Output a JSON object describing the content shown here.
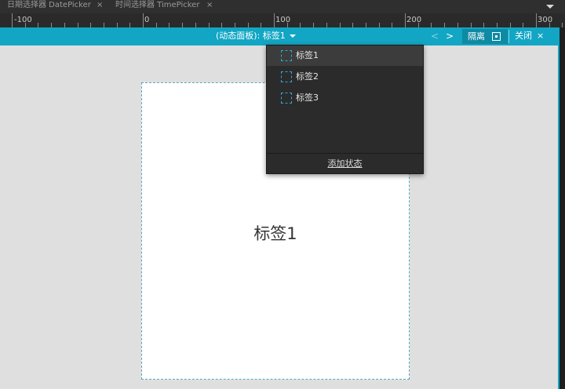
{
  "tabs": [
    {
      "label": "日期选择器 DatePicker",
      "close": "×"
    },
    {
      "label": "时间选择器 TimePicker",
      "close": "×"
    }
  ],
  "ruler": {
    "labels": [
      "-100",
      "0",
      "100",
      "200",
      "300"
    ]
  },
  "panel_bar": {
    "title": "(动态面板): 标签1",
    "prev": "<",
    "next": ">",
    "isolate_label": "隔离",
    "close_label": "关闭",
    "close_icon": "×"
  },
  "state_dropdown": {
    "items": [
      {
        "label": "标签1",
        "selected": true
      },
      {
        "label": "标签2",
        "selected": false
      },
      {
        "label": "标签3",
        "selected": false
      }
    ],
    "add_state": "添加状态"
  },
  "canvas": {
    "label": "标签1"
  },
  "colors": {
    "accent": "#12a6c4",
    "dark": "#2b2b2b",
    "canvas_bg": "#dfdfdf"
  }
}
